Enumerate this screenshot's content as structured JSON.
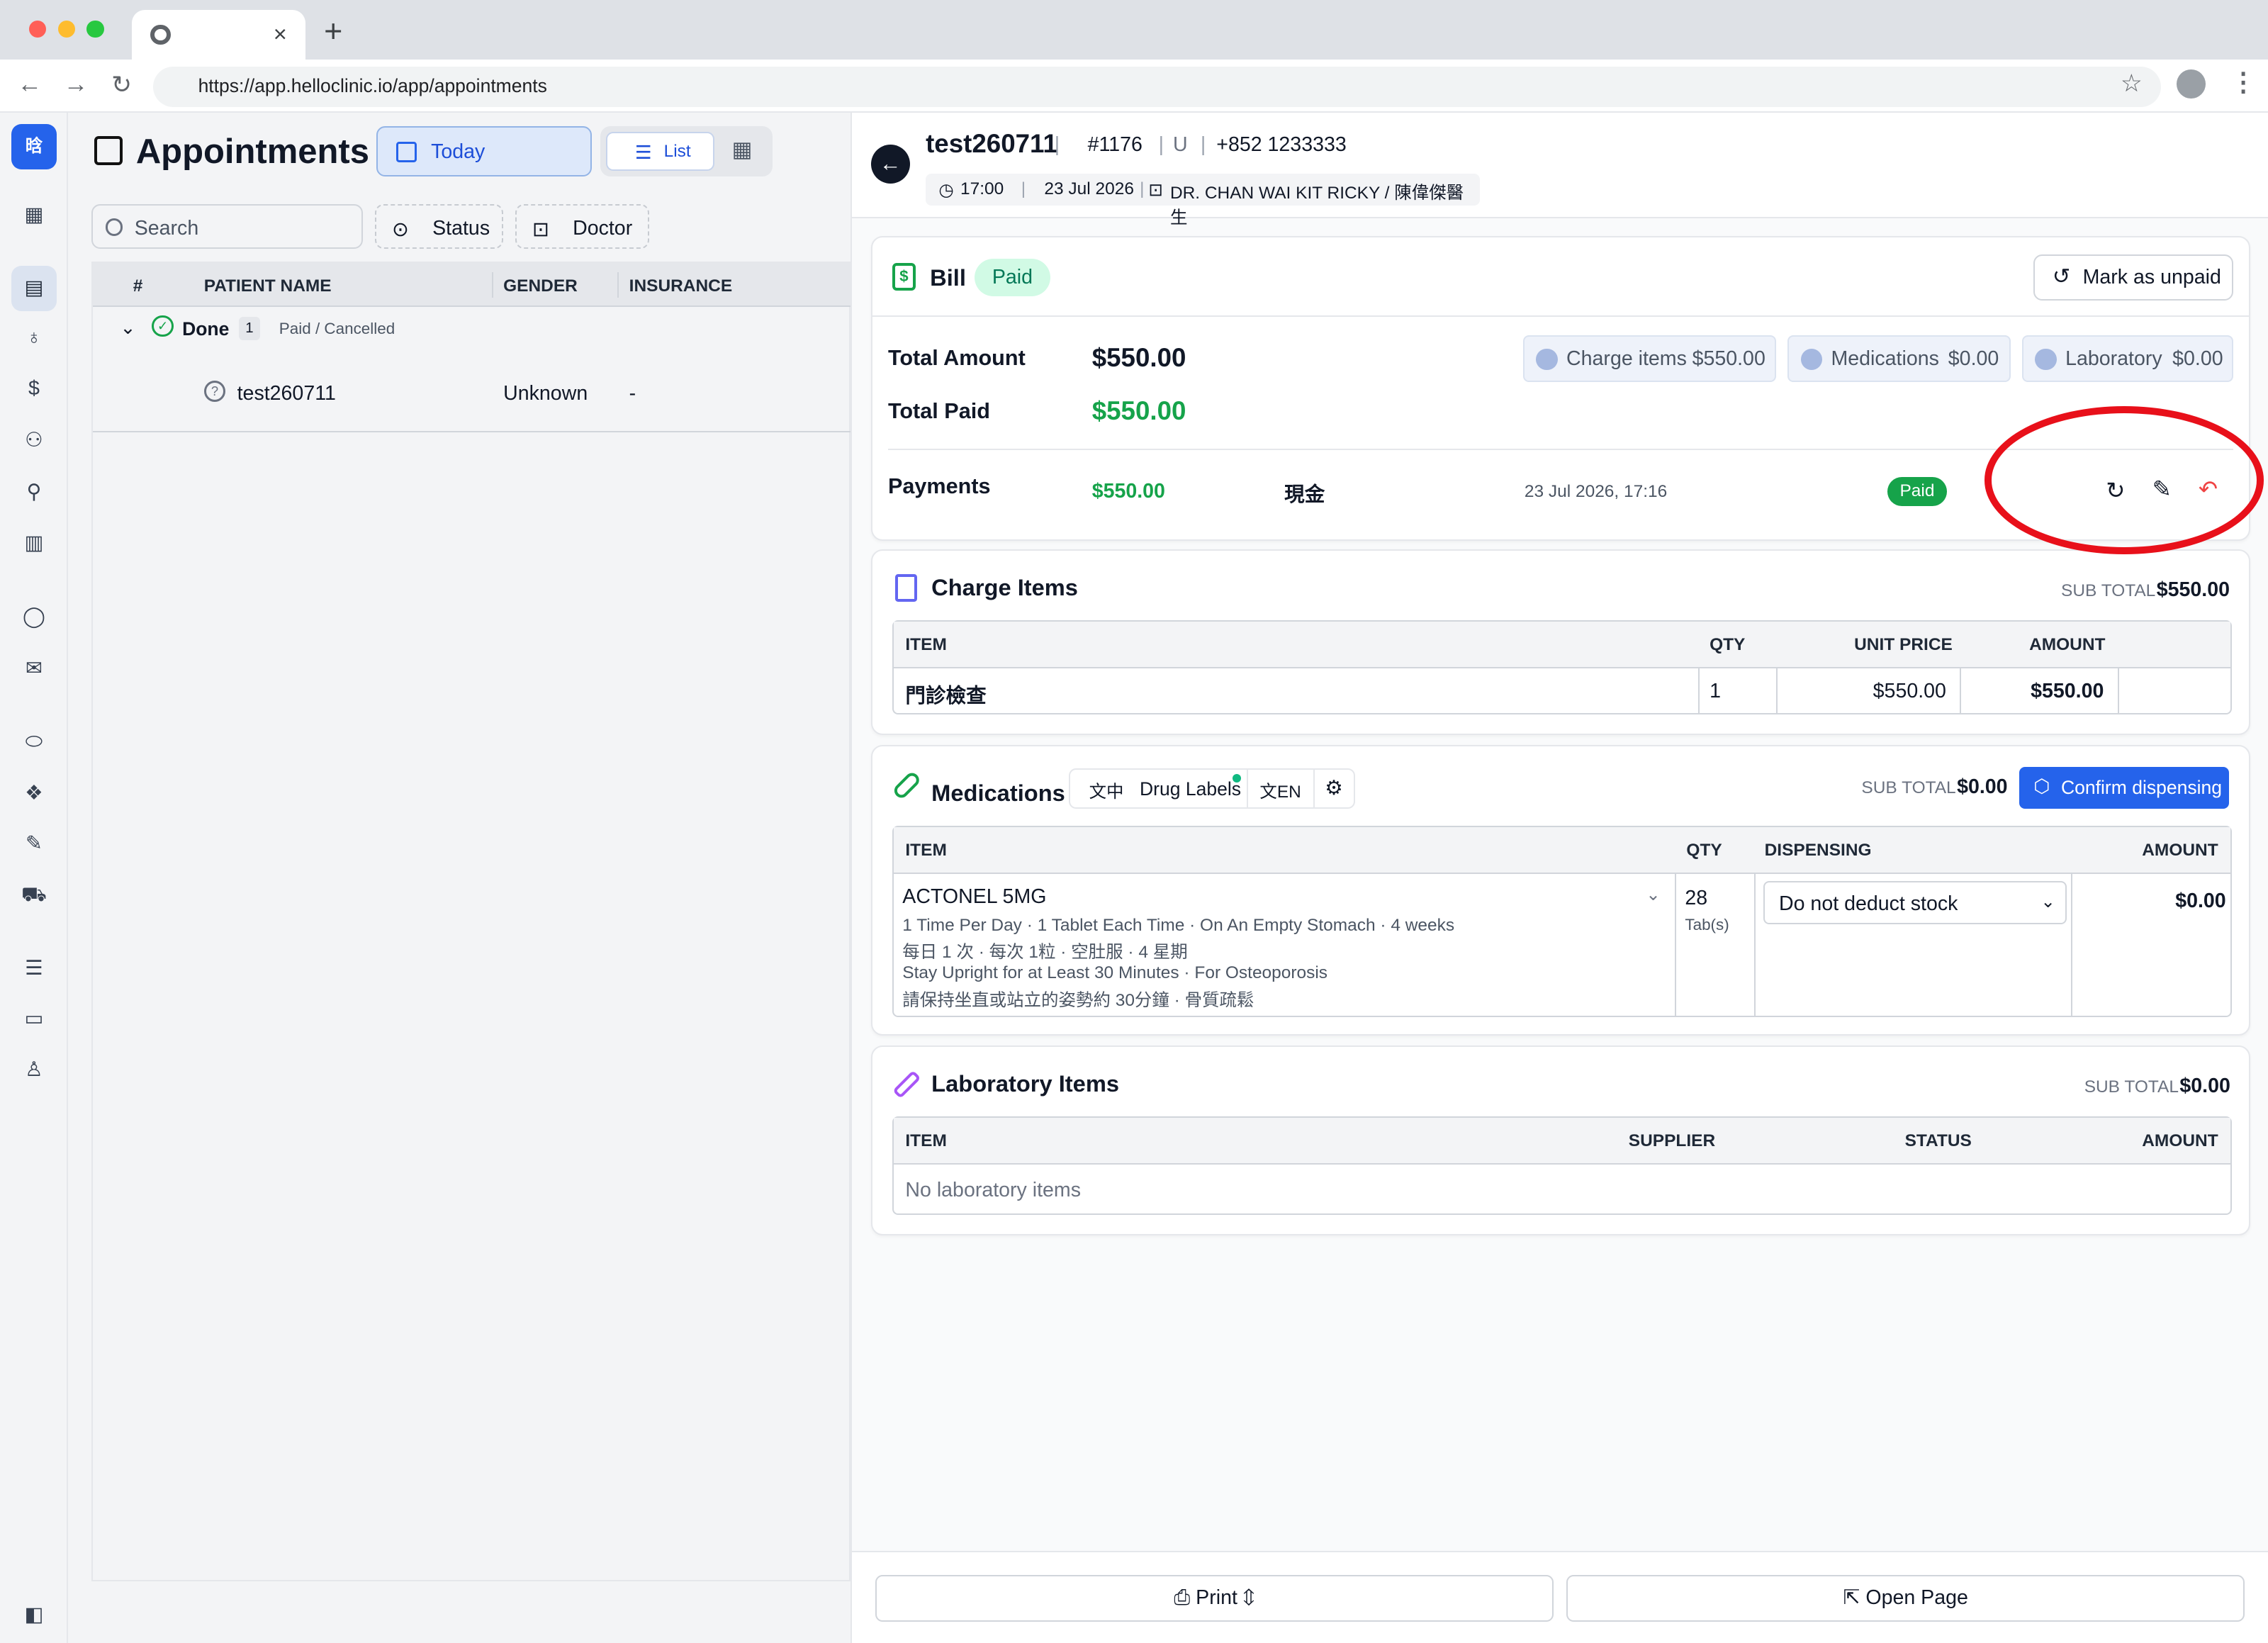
{
  "browser": {
    "url": "https://app.helloclinic.io/app/appointments",
    "new_tab": "+",
    "close": "×",
    "back": "←",
    "forward": "→",
    "reload": "↻",
    "star": "☆",
    "menu": "⋮"
  },
  "sidebar": {
    "logo": "晗",
    "icons": [
      "grid-icon",
      "calendar-icon",
      "stethoscope-icon",
      "dollar-icon",
      "users-icon",
      "user-search-icon",
      "chart-icon",
      "whatsapp-icon",
      "mail-icon",
      "pill-icon",
      "boxes-icon",
      "syringe-icon",
      "truck-icon",
      "sliders-icon",
      "card-icon",
      "user-icon",
      "collapse-icon"
    ]
  },
  "appointments": {
    "title": "Appointments",
    "today": "Today",
    "list": "List",
    "search_placeholder": "Search",
    "filters": [
      "Status",
      "Doctor"
    ],
    "columns": [
      "#",
      "PATIENT NAME",
      "GENDER",
      "INSURANCE"
    ],
    "group": {
      "label": "Done",
      "count": "1",
      "note": "Paid / Cancelled"
    },
    "rows": [
      {
        "name": "test260711",
        "gender": "Unknown",
        "insurance": "-"
      }
    ]
  },
  "detail": {
    "patient": "test260711",
    "number": "#1176",
    "flag": "U",
    "phone": "+852 1233333",
    "time": "17:00",
    "date": "23 Jul 2026",
    "doctor": "DR. CHAN WAI KIT RICKY / 陳偉傑醫生"
  },
  "bill": {
    "title": "Bill",
    "status": "Paid",
    "mark_unpaid": "Mark as unpaid",
    "total_amount_label": "Total Amount",
    "total_amount": "$550.00",
    "total_paid_label": "Total Paid",
    "total_paid": "$550.00",
    "pills": [
      {
        "label": "Charge items",
        "value": "$550.00"
      },
      {
        "label": "Medications",
        "value": "$0.00"
      },
      {
        "label": "Laboratory",
        "value": "$0.00"
      }
    ],
    "payments_label": "Payments",
    "payment": {
      "amount": "$550.00",
      "method": "現金",
      "datetime": "23 Jul 2026, 17:16",
      "status": "Paid"
    }
  },
  "charge": {
    "title": "Charge Items",
    "subtotal_label": "SUB TOTAL",
    "subtotal": "$550.00",
    "columns": [
      "ITEM",
      "QTY",
      "UNIT PRICE",
      "AMOUNT"
    ],
    "rows": [
      {
        "item": "門診檢查",
        "qty": "1",
        "unit": "$550.00",
        "amount": "$550.00"
      }
    ]
  },
  "meds": {
    "title": "Medications",
    "drug_labels": "Drug Labels",
    "lang_zh": "文中",
    "lang_en": "文EN",
    "subtotal_label": "SUB TOTAL",
    "subtotal": "$0.00",
    "confirm": "Confirm dispensing",
    "columns": [
      "ITEM",
      "QTY",
      "DISPENSING",
      "AMOUNT"
    ],
    "row": {
      "name": "ACTONEL 5MG",
      "l1": "1 Time Per Day · 1 Tablet Each Time · On An Empty Stomach · 4 weeks",
      "l2": "每日 1 次 · 每次 1粒 · 空肚服 · 4 星期",
      "l3": "Stay Upright for at Least 30 Minutes · For Osteoporosis",
      "l4": "請保持坐直或站立的姿勢約 30分鐘 · 骨質疏鬆",
      "qty": "28",
      "unit": "Tab(s)",
      "dispensing": "Do not deduct stock",
      "amount": "$0.00"
    }
  },
  "lab": {
    "title": "Laboratory Items",
    "subtotal_label": "SUB TOTAL",
    "subtotal": "$0.00",
    "columns": [
      "ITEM",
      "SUPPLIER",
      "STATUS",
      "AMOUNT"
    ],
    "empty": "No laboratory items"
  },
  "footer": {
    "print": "Print",
    "open": "Open Page"
  },
  "colors": {
    "accent": "#2563eb",
    "paid": "#16a34a",
    "annotation": "#e8101a"
  }
}
